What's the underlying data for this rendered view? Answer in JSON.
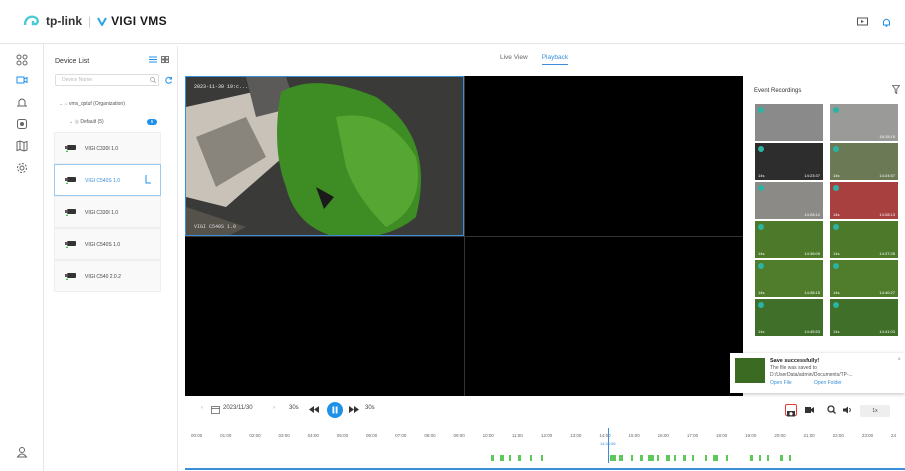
{
  "header": {
    "brand_tp": "tp-link",
    "brand_app": "VIGI VMS"
  },
  "device_panel": {
    "title": "Device List",
    "search_placeholder": "Device Name",
    "org_label": "vms_qstuf (Organization)",
    "group_label": "Default (5)",
    "group_count": "5",
    "devices": [
      {
        "name": "VIGI C330I 1.0"
      },
      {
        "name": "VIGI C540S 1.0"
      },
      {
        "name": "VIGI C330I 1.0"
      },
      {
        "name": "VIGI C540S 1.0"
      },
      {
        "name": "VIGI C540 2.0.2"
      }
    ]
  },
  "tabs": {
    "live": "Live View",
    "playback": "Playback"
  },
  "video": {
    "timestamp": "2023-11-30 19:c...",
    "camera_label": "VIGI C540S 1.0"
  },
  "events": {
    "title": "Event Recordings",
    "thumbs": [
      {
        "len": "",
        "time": "",
        "color": "#8a8a8a"
      },
      {
        "len": "",
        "time": "15:15:19",
        "color": "#9a9a98"
      },
      {
        "len": "14s",
        "time": "14:23:37",
        "color": "#2d2d2d"
      },
      {
        "len": "14s",
        "time": "14:24:57",
        "color": "#6b7a55"
      },
      {
        "len": "",
        "time": "14:28:12",
        "color": "#8c8a86"
      },
      {
        "len": "14s",
        "time": "14:28:13",
        "color": "#a94040"
      },
      {
        "len": "14s",
        "time": "14:36:09",
        "color": "#4c7a2a"
      },
      {
        "len": "14s",
        "time": "14:37:28",
        "color": "#4c7a2a"
      },
      {
        "len": "14s",
        "time": "14:38:15",
        "color": "#4f7d2c"
      },
      {
        "len": "14s",
        "time": "14:40:27",
        "color": "#4f7d2c"
      },
      {
        "len": "14s",
        "time": "14:45:53",
        "color": "#3f6f28"
      },
      {
        "len": "14s",
        "time": "14:41:03",
        "color": "#3f6f28"
      }
    ]
  },
  "toast": {
    "title": "Save successfully!",
    "line1": "The file was saved to",
    "line2": "D:/UserData/admin/Documents/TP-...",
    "open_file": "Open File",
    "open_folder": "Open Folder"
  },
  "controls": {
    "date": "2023/11/30",
    "skip_back": "30s",
    "skip_fwd": "30s",
    "speed": "1x"
  },
  "timeline": {
    "ticks": [
      "00:00",
      "01:00",
      "02:00",
      "03:00",
      "04:00",
      "05:00",
      "06:00",
      "07:00",
      "08:00",
      "09:00",
      "10:00",
      "11:00",
      "12:00",
      "13:00",
      "14:00",
      "15:00",
      "16:00",
      "17:00",
      "18:00",
      "19:00",
      "20:00",
      "21:00",
      "22:00",
      "23:00",
      "24"
    ],
    "cursor_time": "14:35:56"
  },
  "colors": {
    "accent": "#1e90e8",
    "recording": "#5cc95a"
  }
}
